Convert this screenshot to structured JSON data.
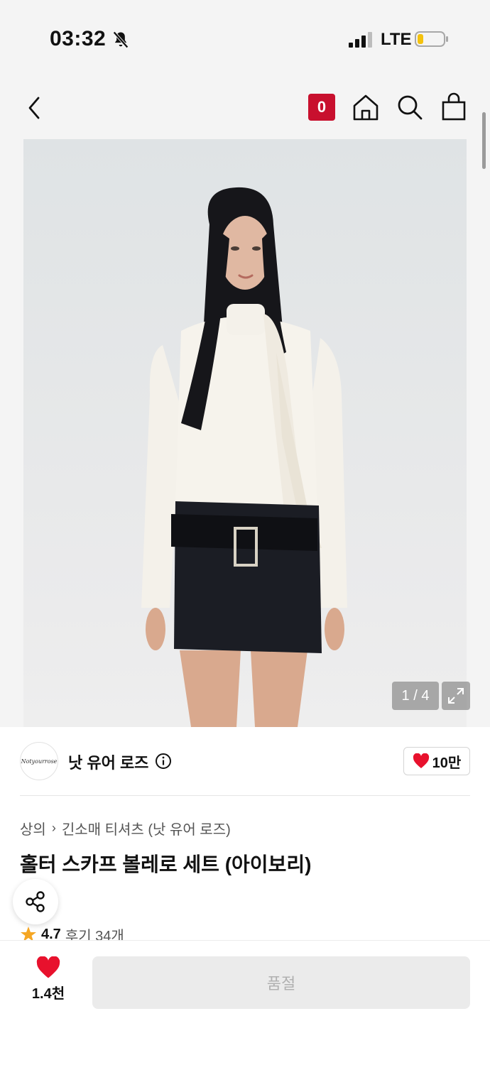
{
  "status_bar": {
    "time": "03:32",
    "network": "LTE",
    "icons": [
      "bell-off-icon",
      "signal-icon",
      "battery-icon"
    ]
  },
  "nav": {
    "cart_count": "0",
    "icons": [
      "back-icon",
      "home-icon",
      "search-icon",
      "bag-icon"
    ]
  },
  "gallery": {
    "counter": "1 / 4"
  },
  "brand": {
    "logo_text": "Notyourrose",
    "name": "낫 유어 로즈",
    "likes": "10만"
  },
  "product": {
    "breadcrumb": [
      "상의",
      "긴소매 티셔츠 (낫 유어 로즈)"
    ],
    "title": "홀터 스카프 볼레로 세트 (아이보리)",
    "rating": "4.7",
    "reviews": "후기 34개"
  },
  "bottom_bar": {
    "wish_count": "1.4천",
    "buy_label": "품절"
  },
  "colors": {
    "accent_red": "#c8102e",
    "heart_red": "#e8112d",
    "star_orange": "#f5a623",
    "disabled_bg": "#ebebeb"
  }
}
